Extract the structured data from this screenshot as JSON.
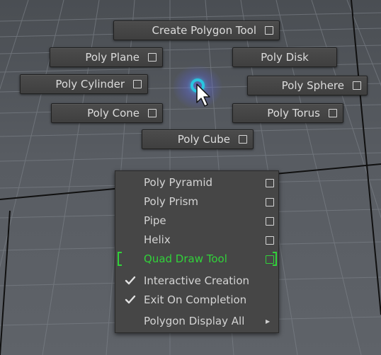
{
  "marking_menu": {
    "create_polygon_tool": "Create Polygon Tool",
    "poly_plane": "Poly Plane",
    "poly_disk": "Poly Disk",
    "poly_cylinder": "Poly Cylinder",
    "poly_sphere": "Poly Sphere",
    "poly_cone": "Poly Cone",
    "poly_torus": "Poly Torus",
    "poly_cube": "Poly Cube"
  },
  "overflow_menu": {
    "items": [
      {
        "label": "Poly Pyramid",
        "has_option_box": true
      },
      {
        "label": "Poly Prism",
        "has_option_box": true
      },
      {
        "label": "Pipe",
        "has_option_box": true
      },
      {
        "label": "Helix",
        "has_option_box": true
      },
      {
        "label": "Quad Draw Tool",
        "has_option_box": true,
        "highlighted": true
      },
      {
        "label": "Interactive Creation",
        "checked": true
      },
      {
        "label": "Exit On Completion",
        "checked": true
      },
      {
        "label": "Polygon Display All",
        "has_submenu": true
      }
    ]
  },
  "colors": {
    "highlight": "#31d23a",
    "center_ring": "#29c6e0",
    "menu_bg": "#464646"
  },
  "icons": [
    "option-box-icon",
    "checkmark-icon",
    "submenu-arrow-icon",
    "mouse-cursor-icon"
  ]
}
